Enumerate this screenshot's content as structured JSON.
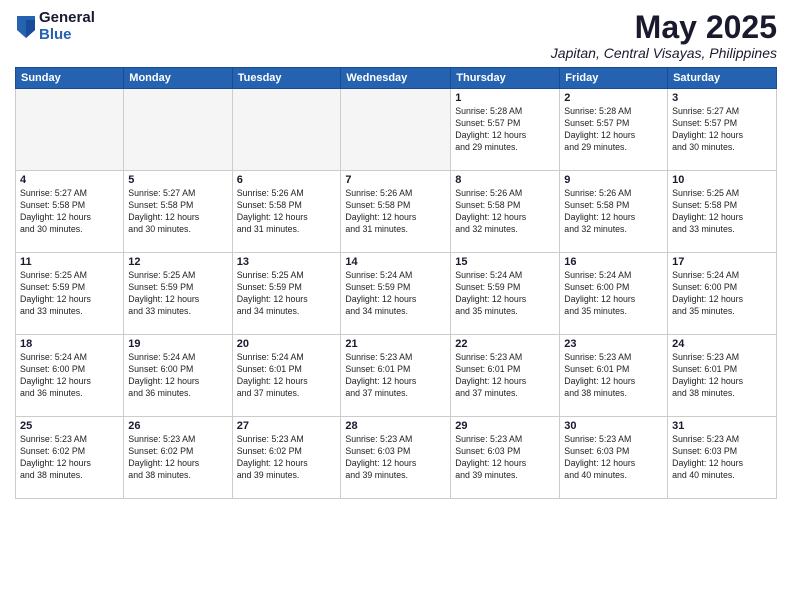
{
  "logo": {
    "general": "General",
    "blue": "Blue"
  },
  "title": "May 2025",
  "location": "Japitan, Central Visayas, Philippines",
  "weekdays": [
    "Sunday",
    "Monday",
    "Tuesday",
    "Wednesday",
    "Thursday",
    "Friday",
    "Saturday"
  ],
  "weeks": [
    [
      {
        "day": "",
        "info": ""
      },
      {
        "day": "",
        "info": ""
      },
      {
        "day": "",
        "info": ""
      },
      {
        "day": "",
        "info": ""
      },
      {
        "day": "1",
        "info": "Sunrise: 5:28 AM\nSunset: 5:57 PM\nDaylight: 12 hours\nand 29 minutes."
      },
      {
        "day": "2",
        "info": "Sunrise: 5:28 AM\nSunset: 5:57 PM\nDaylight: 12 hours\nand 29 minutes."
      },
      {
        "day": "3",
        "info": "Sunrise: 5:27 AM\nSunset: 5:57 PM\nDaylight: 12 hours\nand 30 minutes."
      }
    ],
    [
      {
        "day": "4",
        "info": "Sunrise: 5:27 AM\nSunset: 5:58 PM\nDaylight: 12 hours\nand 30 minutes."
      },
      {
        "day": "5",
        "info": "Sunrise: 5:27 AM\nSunset: 5:58 PM\nDaylight: 12 hours\nand 30 minutes."
      },
      {
        "day": "6",
        "info": "Sunrise: 5:26 AM\nSunset: 5:58 PM\nDaylight: 12 hours\nand 31 minutes."
      },
      {
        "day": "7",
        "info": "Sunrise: 5:26 AM\nSunset: 5:58 PM\nDaylight: 12 hours\nand 31 minutes."
      },
      {
        "day": "8",
        "info": "Sunrise: 5:26 AM\nSunset: 5:58 PM\nDaylight: 12 hours\nand 32 minutes."
      },
      {
        "day": "9",
        "info": "Sunrise: 5:26 AM\nSunset: 5:58 PM\nDaylight: 12 hours\nand 32 minutes."
      },
      {
        "day": "10",
        "info": "Sunrise: 5:25 AM\nSunset: 5:58 PM\nDaylight: 12 hours\nand 33 minutes."
      }
    ],
    [
      {
        "day": "11",
        "info": "Sunrise: 5:25 AM\nSunset: 5:59 PM\nDaylight: 12 hours\nand 33 minutes."
      },
      {
        "day": "12",
        "info": "Sunrise: 5:25 AM\nSunset: 5:59 PM\nDaylight: 12 hours\nand 33 minutes."
      },
      {
        "day": "13",
        "info": "Sunrise: 5:25 AM\nSunset: 5:59 PM\nDaylight: 12 hours\nand 34 minutes."
      },
      {
        "day": "14",
        "info": "Sunrise: 5:24 AM\nSunset: 5:59 PM\nDaylight: 12 hours\nand 34 minutes."
      },
      {
        "day": "15",
        "info": "Sunrise: 5:24 AM\nSunset: 5:59 PM\nDaylight: 12 hours\nand 35 minutes."
      },
      {
        "day": "16",
        "info": "Sunrise: 5:24 AM\nSunset: 6:00 PM\nDaylight: 12 hours\nand 35 minutes."
      },
      {
        "day": "17",
        "info": "Sunrise: 5:24 AM\nSunset: 6:00 PM\nDaylight: 12 hours\nand 35 minutes."
      }
    ],
    [
      {
        "day": "18",
        "info": "Sunrise: 5:24 AM\nSunset: 6:00 PM\nDaylight: 12 hours\nand 36 minutes."
      },
      {
        "day": "19",
        "info": "Sunrise: 5:24 AM\nSunset: 6:00 PM\nDaylight: 12 hours\nand 36 minutes."
      },
      {
        "day": "20",
        "info": "Sunrise: 5:24 AM\nSunset: 6:01 PM\nDaylight: 12 hours\nand 37 minutes."
      },
      {
        "day": "21",
        "info": "Sunrise: 5:23 AM\nSunset: 6:01 PM\nDaylight: 12 hours\nand 37 minutes."
      },
      {
        "day": "22",
        "info": "Sunrise: 5:23 AM\nSunset: 6:01 PM\nDaylight: 12 hours\nand 37 minutes."
      },
      {
        "day": "23",
        "info": "Sunrise: 5:23 AM\nSunset: 6:01 PM\nDaylight: 12 hours\nand 38 minutes."
      },
      {
        "day": "24",
        "info": "Sunrise: 5:23 AM\nSunset: 6:01 PM\nDaylight: 12 hours\nand 38 minutes."
      }
    ],
    [
      {
        "day": "25",
        "info": "Sunrise: 5:23 AM\nSunset: 6:02 PM\nDaylight: 12 hours\nand 38 minutes."
      },
      {
        "day": "26",
        "info": "Sunrise: 5:23 AM\nSunset: 6:02 PM\nDaylight: 12 hours\nand 38 minutes."
      },
      {
        "day": "27",
        "info": "Sunrise: 5:23 AM\nSunset: 6:02 PM\nDaylight: 12 hours\nand 39 minutes."
      },
      {
        "day": "28",
        "info": "Sunrise: 5:23 AM\nSunset: 6:03 PM\nDaylight: 12 hours\nand 39 minutes."
      },
      {
        "day": "29",
        "info": "Sunrise: 5:23 AM\nSunset: 6:03 PM\nDaylight: 12 hours\nand 39 minutes."
      },
      {
        "day": "30",
        "info": "Sunrise: 5:23 AM\nSunset: 6:03 PM\nDaylight: 12 hours\nand 40 minutes."
      },
      {
        "day": "31",
        "info": "Sunrise: 5:23 AM\nSunset: 6:03 PM\nDaylight: 12 hours\nand 40 minutes."
      }
    ]
  ]
}
